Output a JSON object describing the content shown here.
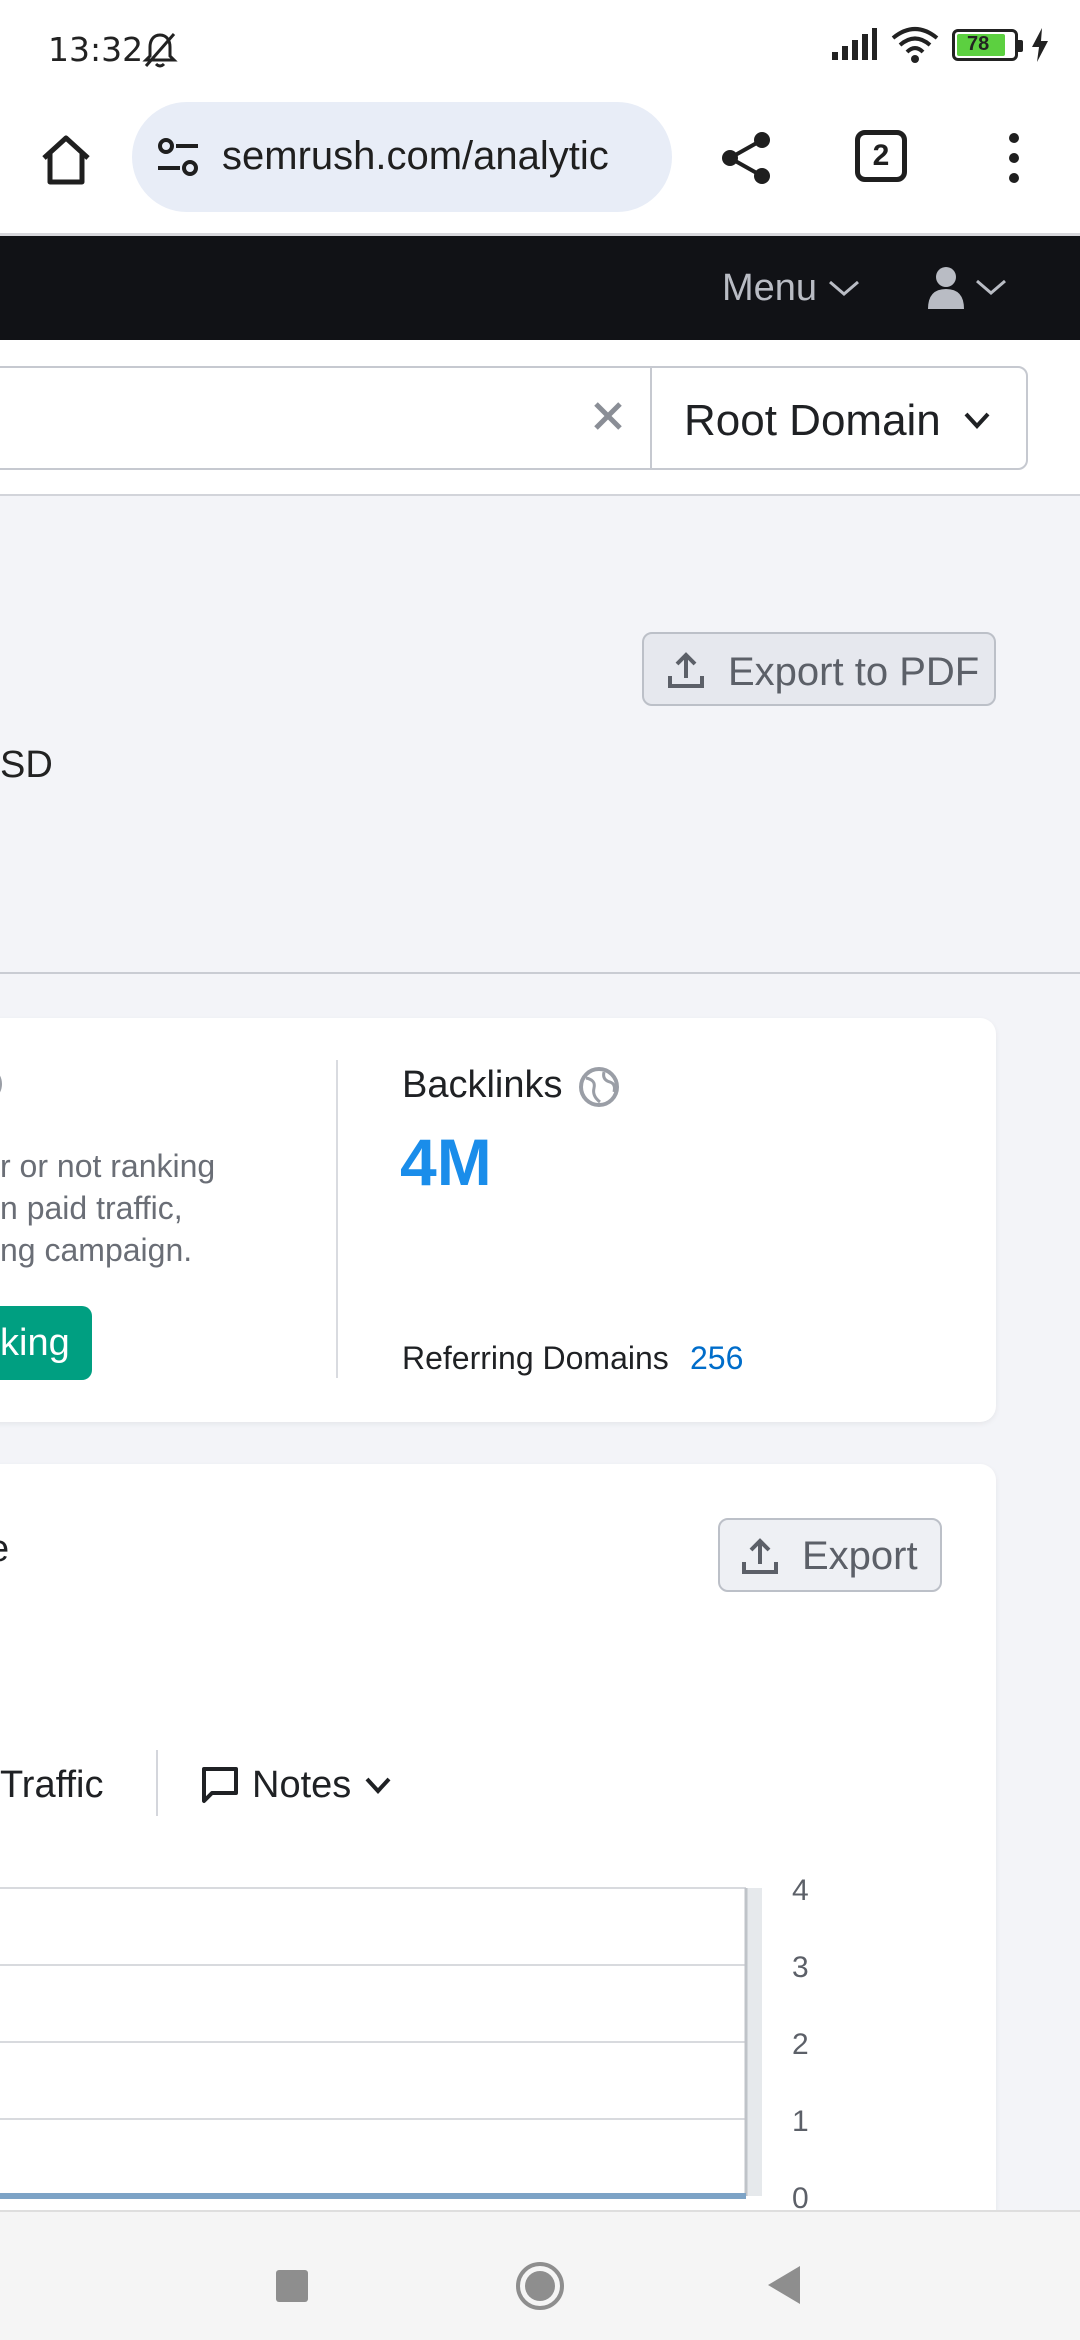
{
  "status_bar": {
    "time": "13:32",
    "battery": "78"
  },
  "browser": {
    "url": "semrush.com/analytic",
    "tab_count": "2"
  },
  "header": {
    "menu_label": "Menu"
  },
  "search": {
    "scope_label": "Root Domain"
  },
  "overview": {
    "export_pdf_label": "Export to PDF",
    "currency_fragment": "SD"
  },
  "backlinks_card": {
    "left_desc": [
      "r or not ranking",
      "n paid traffic,",
      "ng campaign."
    ],
    "left_button": "king",
    "title": "Backlinks",
    "value": "4M",
    "ref_domains_label": "Referring Domains",
    "ref_domains_value": "256"
  },
  "traffic_card": {
    "title_fragment": "e",
    "export_label": "Export",
    "tab_traffic": "Traffic",
    "tab_notes": "Notes"
  },
  "chart_data": {
    "type": "line",
    "y_ticks": [
      "4",
      "3",
      "2",
      "1",
      "0"
    ],
    "ylim": [
      0,
      4
    ],
    "series": [
      {
        "values": [
          0,
          0
        ]
      }
    ],
    "grid": true
  },
  "colors": {
    "header_bg": "#111216",
    "accent_blue": "#1a8dea",
    "link_blue": "#006dca",
    "green_button": "#009f81",
    "page_bg": "#f3f4f8"
  }
}
